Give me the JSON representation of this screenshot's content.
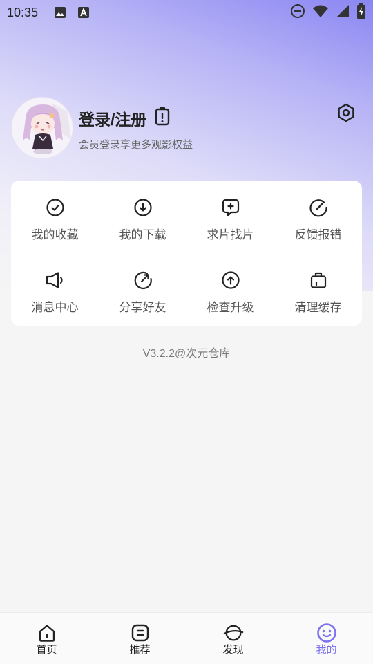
{
  "status_bar": {
    "time": "10:35",
    "left_icons": [
      "image-icon",
      "font-icon"
    ],
    "right_icons": [
      "do-not-disturb-icon",
      "wifi-icon",
      "signal-icon",
      "battery-icon"
    ]
  },
  "profile": {
    "title": "登录/注册",
    "subtitle": "会员登录享更多观影权益",
    "badge_icon": "alert-card-icon",
    "settings_icon": "settings-icon"
  },
  "menu": {
    "items": [
      {
        "label": "我的收藏",
        "icon": "check-circle-icon"
      },
      {
        "label": "我的下载",
        "icon": "download-circle-icon"
      },
      {
        "label": "求片找片",
        "icon": "request-bubble-icon"
      },
      {
        "label": "反馈报错",
        "icon": "feedback-icon"
      },
      {
        "label": "消息中心",
        "icon": "speaker-icon"
      },
      {
        "label": "分享好友",
        "icon": "share-icon"
      },
      {
        "label": "检查升级",
        "icon": "upgrade-icon"
      },
      {
        "label": "清理缓存",
        "icon": "clear-cache-icon"
      }
    ]
  },
  "version": "V3.2.2@次元仓库",
  "tabbar": {
    "tabs": [
      {
        "label": "首页",
        "icon": "home-icon",
        "active": false
      },
      {
        "label": "推荐",
        "icon": "recommend-icon",
        "active": false
      },
      {
        "label": "发现",
        "icon": "discover-icon",
        "active": false
      },
      {
        "label": "我的",
        "icon": "profile-smile-icon",
        "active": true
      }
    ]
  },
  "colors": {
    "accent": "#7c74ef",
    "gradient_top": "#8a86f2",
    "page_bg": "#f5f5f5"
  }
}
